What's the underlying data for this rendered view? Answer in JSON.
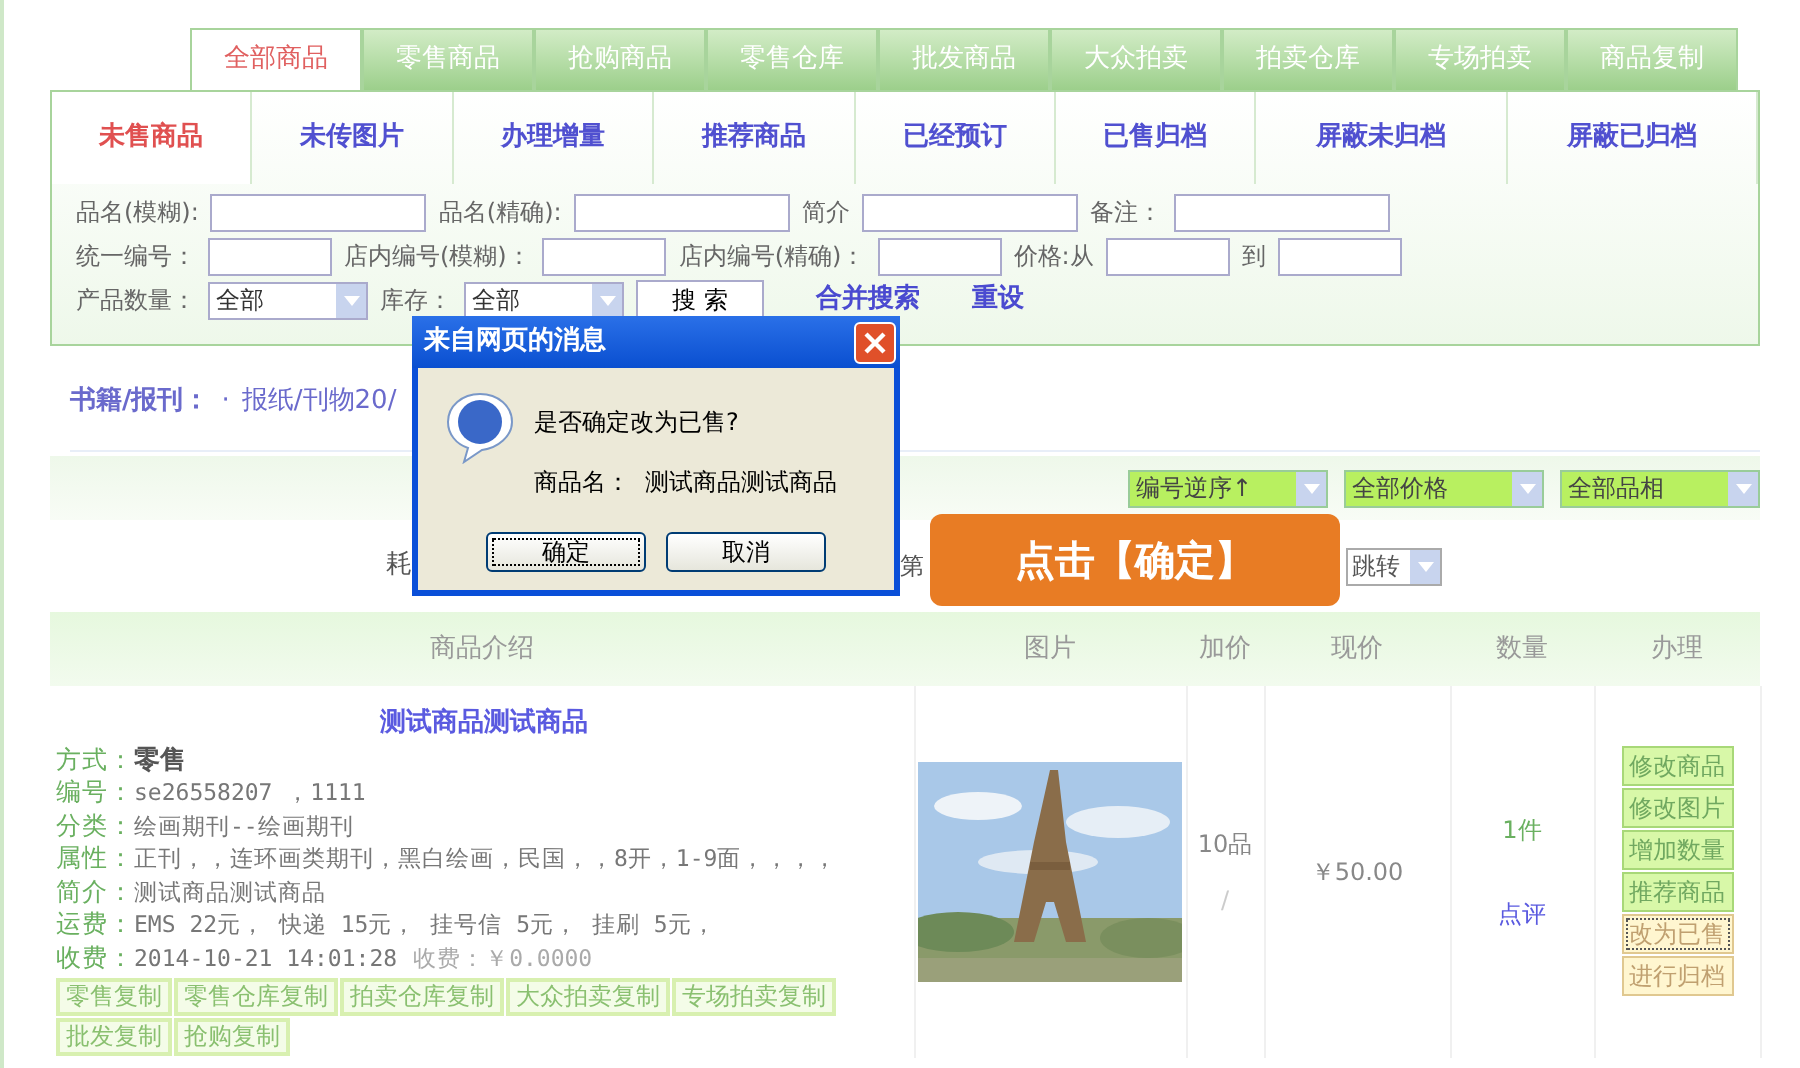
{
  "top_tabs": [
    {
      "label": "全部商品",
      "selected": true
    },
    {
      "label": "零售商品",
      "selected": false
    },
    {
      "label": "抢购商品",
      "selected": false
    },
    {
      "label": "零售仓库",
      "selected": false
    },
    {
      "label": "批发商品",
      "selected": false
    },
    {
      "label": "大众拍卖",
      "selected": false
    },
    {
      "label": "拍卖仓库",
      "selected": false
    },
    {
      "label": "专场拍卖",
      "selected": false
    },
    {
      "label": "商品复制",
      "selected": false
    }
  ],
  "sub_tabs": [
    {
      "label": "未售商品",
      "selected": true
    },
    {
      "label": "未传图片",
      "selected": false
    },
    {
      "label": "办理增量",
      "selected": false
    },
    {
      "label": "推荐商品",
      "selected": false
    },
    {
      "label": "已经预订",
      "selected": false
    },
    {
      "label": "已售归档",
      "selected": false
    },
    {
      "label": "屏蔽未归档",
      "selected": false
    },
    {
      "label": "屏蔽已归档",
      "selected": false
    }
  ],
  "search_form": {
    "rows": [
      [
        {
          "kind": "input",
          "label": "品名(模糊):"
        },
        {
          "kind": "input",
          "label": "品名(精确):"
        },
        {
          "kind": "input",
          "label": "简介"
        },
        {
          "kind": "input",
          "label": "备注："
        }
      ],
      [
        {
          "kind": "input",
          "label": "统一编号："
        },
        {
          "kind": "input",
          "label": "店内编号(模糊)："
        },
        {
          "kind": "input",
          "label": "店内编号(精确)："
        },
        {
          "kind": "input",
          "label": "价格:从"
        },
        {
          "kind": "input",
          "label": "到"
        }
      ],
      [
        {
          "kind": "select",
          "label": "产品数量：",
          "value": "全部"
        },
        {
          "kind": "select",
          "label": "库存：",
          "value": "全部"
        },
        {
          "kind": "button",
          "label": "搜 索"
        },
        {
          "kind": "link",
          "label": "合并搜索"
        },
        {
          "kind": "link",
          "label": "重设"
        }
      ]
    ]
  },
  "breadcrumb": {
    "label": "书籍/报刊：",
    "separator": "·",
    "item": "报纸/刊物20/"
  },
  "sort_selects": [
    {
      "value": "编号逆序↑"
    },
    {
      "value": "全部价格"
    },
    {
      "value": "全部品相"
    }
  ],
  "pager": {
    "text_1": "耗",
    "text_2": "第",
    "jump_select": "跳转"
  },
  "table": {
    "columns": [
      "商品介绍",
      "图片",
      "加价",
      "现价",
      "数量",
      "办理"
    ],
    "rows": [
      {
        "title": "测试商品测试商品",
        "details": [
          {
            "label": "方式：",
            "value": "零售",
            "bold": true
          },
          {
            "label": "编号：",
            "value": "se26558207 ，1111",
            "bold": false
          },
          {
            "label": "分类：",
            "value": "绘画期刊--绘画期刊",
            "bold": false
          },
          {
            "label": "属性：",
            "value": "正刊，，连环画类期刊，黑白绘画，民国，，8开，1-9面，，，，",
            "bold": false
          },
          {
            "label": "简介：",
            "value": "测试商品测试商品",
            "bold": false
          },
          {
            "label": "运费：",
            "value": "EMS 22元， 快递 15元， 挂号信 5元， 挂刷 5元，",
            "bold": false
          },
          {
            "label": "收费：",
            "value": "2014-10-21 14:01:28",
            "bold": false,
            "extra": "收费：￥0.0000"
          }
        ],
        "copy_buttons": [
          "零售复制",
          "零售仓库复制",
          "拍卖仓库复制",
          "大众拍卖复制",
          "专场拍卖复制",
          "批发复制",
          "抢购复制"
        ],
        "markup": "10品",
        "markup_sub": "/",
        "price": "￥50.00",
        "quantity": "1件",
        "review": "点评",
        "actions": [
          {
            "label": "修改商品",
            "kind": "green",
            "focused": false
          },
          {
            "label": "修改图片",
            "kind": "green",
            "focused": false
          },
          {
            "label": "增加数量",
            "kind": "green",
            "focused": false
          },
          {
            "label": "推荐商品",
            "kind": "green",
            "focused": false
          },
          {
            "label": "改为已售",
            "kind": "yellow",
            "focused": true
          },
          {
            "label": "进行归档",
            "kind": "yellow",
            "focused": false
          }
        ]
      }
    ]
  },
  "dialog": {
    "title": "来自网页的消息",
    "message": "是否确定改为已售?",
    "detail": "商品名：  测试商品测试商品",
    "buttons": [
      {
        "label": "确定",
        "focused": true
      },
      {
        "label": "取消",
        "focused": false
      }
    ]
  },
  "callout": "点击【确定】"
}
